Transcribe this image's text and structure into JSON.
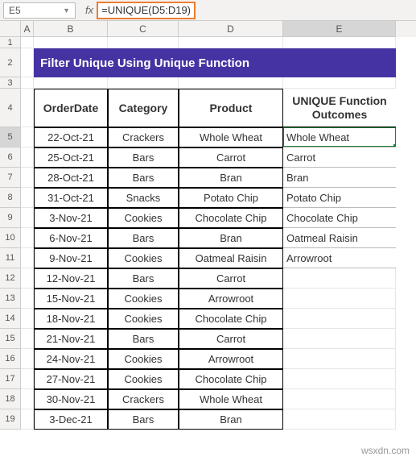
{
  "namebox": {
    "value": "E5"
  },
  "formula": "=UNIQUE(D5:D19)",
  "columns": [
    "A",
    "B",
    "C",
    "D",
    "E"
  ],
  "row_numbers": [
    1,
    2,
    3,
    4,
    5,
    6,
    7,
    8,
    9,
    10,
    11,
    12,
    13,
    14,
    15,
    16,
    17,
    18,
    19
  ],
  "banner_title": "Filter Unique Using Unique Function",
  "headers": {
    "b": "OrderDate",
    "c": "Category",
    "d": "Product",
    "e": "UNIQUE Function Outcomes"
  },
  "rows": [
    {
      "b": "22-Oct-21",
      "c": "Crackers",
      "d": "Whole Wheat"
    },
    {
      "b": "25-Oct-21",
      "c": "Bars",
      "d": "Carrot"
    },
    {
      "b": "28-Oct-21",
      "c": "Bars",
      "d": "Bran"
    },
    {
      "b": "31-Oct-21",
      "c": "Snacks",
      "d": "Potato Chip"
    },
    {
      "b": "3-Nov-21",
      "c": "Cookies",
      "d": "Chocolate Chip"
    },
    {
      "b": "6-Nov-21",
      "c": "Bars",
      "d": "Bran"
    },
    {
      "b": "9-Nov-21",
      "c": "Cookies",
      "d": "Oatmeal Raisin"
    },
    {
      "b": "12-Nov-21",
      "c": "Bars",
      "d": "Carrot"
    },
    {
      "b": "15-Nov-21",
      "c": "Cookies",
      "d": "Arrowroot"
    },
    {
      "b": "18-Nov-21",
      "c": "Cookies",
      "d": "Chocolate Chip"
    },
    {
      "b": "21-Nov-21",
      "c": "Bars",
      "d": "Carrot"
    },
    {
      "b": "24-Nov-21",
      "c": "Cookies",
      "d": "Arrowroot"
    },
    {
      "b": "27-Nov-21",
      "c": "Cookies",
      "d": "Chocolate Chip"
    },
    {
      "b": "30-Nov-21",
      "c": "Crackers",
      "d": "Whole Wheat"
    },
    {
      "b": "3-Dec-21",
      "c": "Bars",
      "d": "Bran"
    }
  ],
  "unique_out": [
    "Whole Wheat",
    "Carrot",
    "Bran",
    "Potato Chip",
    "Chocolate Chip",
    "Oatmeal Raisin",
    "Arrowroot"
  ],
  "active_cell": {
    "row": 5,
    "col": "E"
  },
  "watermark": "wsxdn.com"
}
